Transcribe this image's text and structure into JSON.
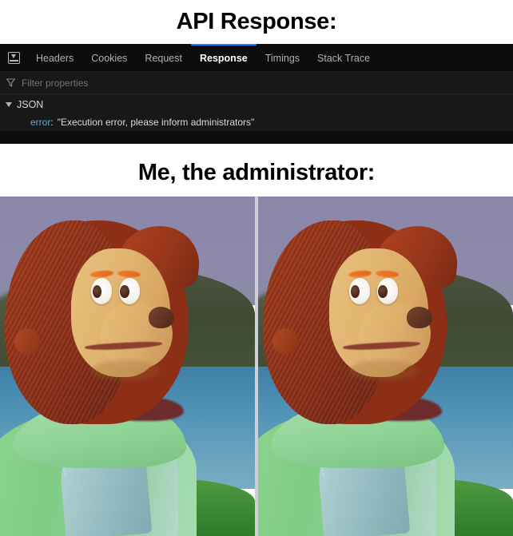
{
  "captions": {
    "top": "API Response:",
    "bottom": "Me, the administrator:"
  },
  "devtools": {
    "panel_icon_name": "network-details-panel-icon",
    "tabs": [
      {
        "label": "Headers",
        "active": false
      },
      {
        "label": "Cookies",
        "active": false
      },
      {
        "label": "Request",
        "active": false
      },
      {
        "label": "Response",
        "active": true
      },
      {
        "label": "Timings",
        "active": false
      },
      {
        "label": "Stack Trace",
        "active": false
      }
    ],
    "filter": {
      "placeholder": "Filter properties",
      "value": "",
      "icon": "funnel-icon"
    },
    "tree": {
      "root_label": "JSON",
      "expanded": true,
      "entries": [
        {
          "key": "error",
          "separator": ":",
          "value": "\"Execution error, please inform administrators\""
        }
      ]
    },
    "colors": {
      "background": "#0c0c0d",
      "body_background": "#18181a",
      "active_tab_underline": "#0a84ff",
      "tab_text": "#b1b1b3",
      "active_tab_text": "#ffffff",
      "placeholder_text": "#737373",
      "json_key": "#5db0d7",
      "json_string": "#dcdcdc"
    }
  },
  "meme": {
    "alt": "Awkward Look Monkey Puppet meme, two identical side-by-side frames",
    "panels": [
      {
        "name": "monkey-puppet-frame-left"
      },
      {
        "name": "monkey-puppet-frame-right"
      }
    ],
    "scene_colors": {
      "sky": "#8b87a9",
      "hill": "#45533a",
      "water": "#4f92b5",
      "grass": "#3f8a35",
      "hair": "#97351a",
      "face": "#e2b673",
      "shirt": "#8fd68f",
      "nose": "#5e3322"
    }
  }
}
